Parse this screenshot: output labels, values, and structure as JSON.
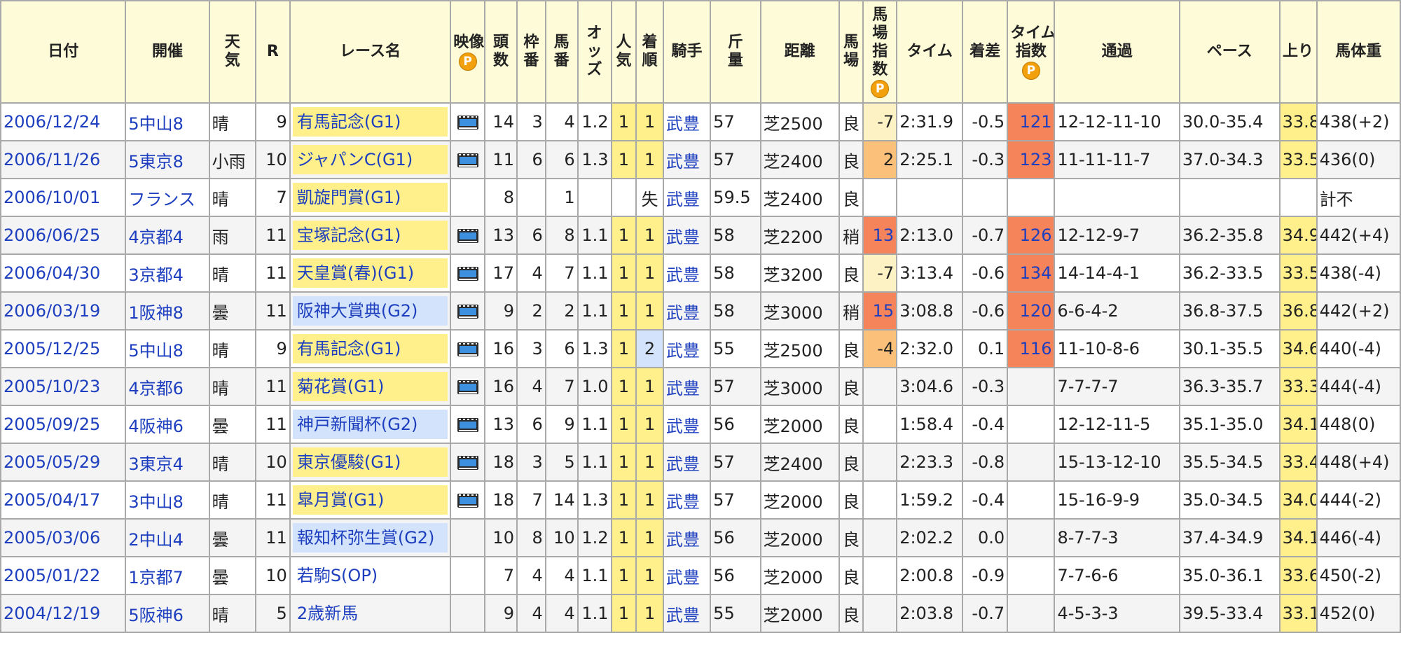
{
  "headers": {
    "date": "日付",
    "meet": "開催",
    "weather_lines": [
      "天",
      "気"
    ],
    "race_no": "R",
    "race_name": "レース名",
    "video": "映像",
    "heads_lines": [
      "頭",
      "数"
    ],
    "frame_lines": [
      "枠",
      "番"
    ],
    "horse_no_lines": [
      "馬",
      "番"
    ],
    "odds_lines": [
      "オ",
      "ッ",
      "ズ"
    ],
    "pop_lines": [
      "人",
      "気"
    ],
    "finish_lines": [
      "着",
      "順"
    ],
    "jockey": "騎手",
    "weight_lines": [
      "斤",
      "量"
    ],
    "distance": "距離",
    "track_lines": [
      "馬",
      "場"
    ],
    "track_index_lines": [
      "馬",
      "場",
      "指",
      "数"
    ],
    "time": "タイム",
    "margin": "着差",
    "time_index_lines": [
      "タイム",
      "指数"
    ],
    "passing": "通過",
    "pace": "ペース",
    "last3f": "上り",
    "body_weight": "馬体重",
    "premium_badge": "P"
  },
  "rows": [
    {
      "date": "2006/12/24",
      "meet": "5中山8",
      "weather": "晴",
      "r": "9",
      "race": "有馬記念(G1)",
      "grade": "G1",
      "video": true,
      "heads": "14",
      "frame": "3",
      "horse": "4",
      "odds": "1.2",
      "pop": "1",
      "finish": "1",
      "jockey": "武豊",
      "weight": "57",
      "distance": "芝2500",
      "track": "良",
      "track_index": "-7",
      "track_index_level": "c1",
      "time": "2:31.9",
      "margin": "-0.5",
      "time_index": "121",
      "passing": "12-12-11-10",
      "pace": "30.0-35.4",
      "last3f": "33.8",
      "last3f_hl": true,
      "body": "438(+2)"
    },
    {
      "date": "2006/11/26",
      "meet": "5東京8",
      "weather": "小雨",
      "r": "10",
      "race": "ジャパンC(G1)",
      "grade": "G1",
      "video": true,
      "heads": "11",
      "frame": "6",
      "horse": "6",
      "odds": "1.3",
      "pop": "1",
      "finish": "1",
      "jockey": "武豊",
      "weight": "57",
      "distance": "芝2400",
      "track": "良",
      "track_index": "2",
      "track_index_level": "c2",
      "time": "2:25.1",
      "margin": "-0.3",
      "time_index": "123",
      "passing": "11-11-11-7",
      "pace": "37.0-34.3",
      "last3f": "33.5",
      "last3f_hl": true,
      "body": "436(0)"
    },
    {
      "date": "2006/10/01",
      "meet": "フランス",
      "weather": "晴",
      "r": "7",
      "race": "凱旋門賞(G1)",
      "grade": "G1",
      "video": false,
      "heads": "8",
      "frame": "",
      "horse": "1",
      "odds": "",
      "pop": "",
      "finish": "失",
      "jockey": "武豊",
      "weight": "59.5",
      "distance": "芝2400",
      "track": "良",
      "track_index": "",
      "track_index_level": "",
      "time": "",
      "margin": "",
      "time_index": "",
      "passing": "",
      "pace": "",
      "last3f": "",
      "last3f_hl": false,
      "body": "計不"
    },
    {
      "date": "2006/06/25",
      "meet": "4京都4",
      "weather": "雨",
      "r": "11",
      "race": "宝塚記念(G1)",
      "grade": "G1",
      "video": true,
      "heads": "13",
      "frame": "6",
      "horse": "8",
      "odds": "1.1",
      "pop": "1",
      "finish": "1",
      "jockey": "武豊",
      "weight": "58",
      "distance": "芝2200",
      "track": "稍",
      "track_index": "13",
      "track_index_level": "r",
      "time": "2:13.0",
      "margin": "-0.7",
      "time_index": "126",
      "passing": "12-12-9-7",
      "pace": "36.2-35.8",
      "last3f": "34.9",
      "last3f_hl": true,
      "body": "442(+4)"
    },
    {
      "date": "2006/04/30",
      "meet": "3京都4",
      "weather": "晴",
      "r": "11",
      "race": "天皇賞(春)(G1)",
      "grade": "G1",
      "video": true,
      "heads": "17",
      "frame": "4",
      "horse": "7",
      "odds": "1.1",
      "pop": "1",
      "finish": "1",
      "jockey": "武豊",
      "weight": "58",
      "distance": "芝3200",
      "track": "良",
      "track_index": "-7",
      "track_index_level": "c1",
      "time": "3:13.4",
      "margin": "-0.6",
      "time_index": "134",
      "passing": "14-14-4-1",
      "pace": "36.2-33.5",
      "last3f": "33.5",
      "last3f_hl": true,
      "body": "438(-4)"
    },
    {
      "date": "2006/03/19",
      "meet": "1阪神8",
      "weather": "曇",
      "r": "11",
      "race": "阪神大賞典(G2)",
      "grade": "G2",
      "video": true,
      "heads": "9",
      "frame": "2",
      "horse": "2",
      "odds": "1.1",
      "pop": "1",
      "finish": "1",
      "jockey": "武豊",
      "weight": "58",
      "distance": "芝3000",
      "track": "稍",
      "track_index": "15",
      "track_index_level": "r",
      "time": "3:08.8",
      "margin": "-0.6",
      "time_index": "120",
      "passing": "6-6-4-2",
      "pace": "36.8-37.5",
      "last3f": "36.8",
      "last3f_hl": true,
      "body": "442(+2)"
    },
    {
      "date": "2005/12/25",
      "meet": "5中山8",
      "weather": "晴",
      "r": "9",
      "race": "有馬記念(G1)",
      "grade": "G1",
      "video": true,
      "heads": "16",
      "frame": "3",
      "horse": "6",
      "odds": "1.3",
      "pop": "1",
      "finish": "2",
      "jockey": "武豊",
      "weight": "55",
      "distance": "芝2500",
      "track": "良",
      "track_index": "-4",
      "track_index_level": "c2",
      "time": "2:32.0",
      "margin": "0.1",
      "time_index": "116",
      "passing": "11-10-8-6",
      "pace": "30.1-35.5",
      "last3f": "34.6",
      "last3f_hl": true,
      "body": "440(-4)"
    },
    {
      "date": "2005/10/23",
      "meet": "4京都6",
      "weather": "晴",
      "r": "11",
      "race": "菊花賞(G1)",
      "grade": "G1",
      "video": true,
      "heads": "16",
      "frame": "4",
      "horse": "7",
      "odds": "1.0",
      "pop": "1",
      "finish": "1",
      "jockey": "武豊",
      "weight": "57",
      "distance": "芝3000",
      "track": "良",
      "track_index": "",
      "track_index_level": "",
      "time": "3:04.6",
      "margin": "-0.3",
      "time_index": "",
      "passing": "7-7-7-7",
      "pace": "36.3-35.7",
      "last3f": "33.3",
      "last3f_hl": true,
      "body": "444(-4)"
    },
    {
      "date": "2005/09/25",
      "meet": "4阪神6",
      "weather": "曇",
      "r": "11",
      "race": "神戸新聞杯(G2)",
      "grade": "G2",
      "video": true,
      "heads": "13",
      "frame": "6",
      "horse": "9",
      "odds": "1.1",
      "pop": "1",
      "finish": "1",
      "jockey": "武豊",
      "weight": "56",
      "distance": "芝2000",
      "track": "良",
      "track_index": "",
      "track_index_level": "",
      "time": "1:58.4",
      "margin": "-0.4",
      "time_index": "",
      "passing": "12-12-11-5",
      "pace": "35.1-35.0",
      "last3f": "34.1",
      "last3f_hl": true,
      "body": "448(0)"
    },
    {
      "date": "2005/05/29",
      "meet": "3東京4",
      "weather": "晴",
      "r": "10",
      "race": "東京優駿(G1)",
      "grade": "G1",
      "video": true,
      "heads": "18",
      "frame": "3",
      "horse": "5",
      "odds": "1.1",
      "pop": "1",
      "finish": "1",
      "jockey": "武豊",
      "weight": "57",
      "distance": "芝2400",
      "track": "良",
      "track_index": "",
      "track_index_level": "",
      "time": "2:23.3",
      "margin": "-0.8",
      "time_index": "",
      "passing": "15-13-12-10",
      "pace": "35.5-34.5",
      "last3f": "33.4",
      "last3f_hl": true,
      "body": "448(+4)"
    },
    {
      "date": "2005/04/17",
      "meet": "3中山8",
      "weather": "晴",
      "r": "11",
      "race": "皐月賞(G1)",
      "grade": "G1",
      "video": true,
      "heads": "18",
      "frame": "7",
      "horse": "14",
      "odds": "1.3",
      "pop": "1",
      "finish": "1",
      "jockey": "武豊",
      "weight": "57",
      "distance": "芝2000",
      "track": "良",
      "track_index": "",
      "track_index_level": "",
      "time": "1:59.2",
      "margin": "-0.4",
      "time_index": "",
      "passing": "15-16-9-9",
      "pace": "35.0-34.5",
      "last3f": "34.0",
      "last3f_hl": true,
      "body": "444(-2)"
    },
    {
      "date": "2005/03/06",
      "meet": "2中山4",
      "weather": "曇",
      "r": "11",
      "race": "報知杯弥生賞(G2)",
      "grade": "G2",
      "video": false,
      "heads": "10",
      "frame": "8",
      "horse": "10",
      "odds": "1.2",
      "pop": "1",
      "finish": "1",
      "jockey": "武豊",
      "weight": "56",
      "distance": "芝2000",
      "track": "良",
      "track_index": "",
      "track_index_level": "",
      "time": "2:02.2",
      "margin": "0.0",
      "time_index": "",
      "passing": "8-7-7-3",
      "pace": "37.4-34.9",
      "last3f": "34.1",
      "last3f_hl": true,
      "body": "446(-4)"
    },
    {
      "date": "2005/01/22",
      "meet": "1京都7",
      "weather": "曇",
      "r": "10",
      "race": "若駒S(OP)",
      "grade": "",
      "video": false,
      "heads": "7",
      "frame": "4",
      "horse": "4",
      "odds": "1.1",
      "pop": "1",
      "finish": "1",
      "jockey": "武豊",
      "weight": "56",
      "distance": "芝2000",
      "track": "良",
      "track_index": "",
      "track_index_level": "",
      "time": "2:00.8",
      "margin": "-0.9",
      "time_index": "",
      "passing": "7-7-6-6",
      "pace": "35.0-36.1",
      "last3f": "33.6",
      "last3f_hl": true,
      "body": "450(-2)"
    },
    {
      "date": "2004/12/19",
      "meet": "5阪神6",
      "weather": "晴",
      "r": "5",
      "race": "2歳新馬",
      "grade": "",
      "video": false,
      "heads": "9",
      "frame": "4",
      "horse": "4",
      "odds": "1.1",
      "pop": "1",
      "finish": "1",
      "jockey": "武豊",
      "weight": "55",
      "distance": "芝2000",
      "track": "良",
      "track_index": "",
      "track_index_level": "",
      "time": "2:03.8",
      "margin": "-0.7",
      "time_index": "",
      "passing": "4-5-3-3",
      "pace": "39.5-33.4",
      "last3f": "33.1",
      "last3f_hl": true,
      "body": "452(0)"
    }
  ]
}
